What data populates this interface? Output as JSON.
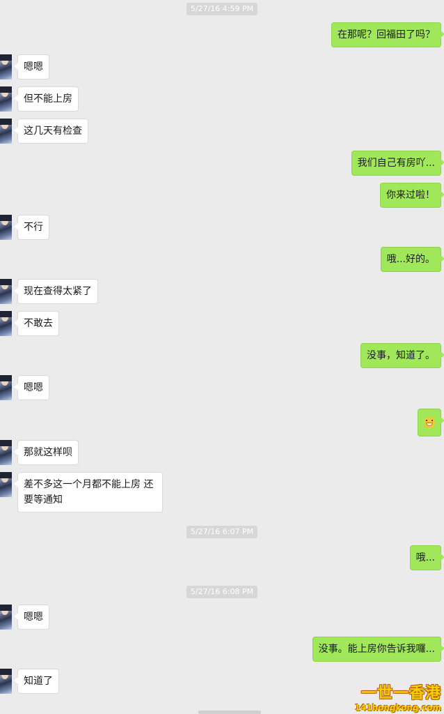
{
  "timestamps": [
    "5/27/16 4:59 PM",
    "5/27/16 6:07 PM",
    "5/27/16 6:08 PM"
  ],
  "messages": [
    {
      "side": "out",
      "text": "在那呢？回福田了吗？"
    },
    {
      "side": "in",
      "text": "嗯嗯"
    },
    {
      "side": "in",
      "text": "但不能上房"
    },
    {
      "side": "in",
      "text": "这几天有检查"
    },
    {
      "side": "out",
      "text": "我们自己有房吖..."
    },
    {
      "side": "out",
      "text": "你来过啦！"
    },
    {
      "side": "in",
      "text": "不行"
    },
    {
      "side": "out",
      "text": "哦...好的。"
    },
    {
      "side": "in",
      "text": "现在查得太紧了"
    },
    {
      "side": "in",
      "text": "不敢去"
    },
    {
      "side": "out",
      "text": "没事，知道了。"
    },
    {
      "side": "in",
      "text": "嗯嗯"
    },
    {
      "side": "out",
      "text": "",
      "icon": "grinning-emoji-icon"
    },
    {
      "side": "in",
      "text": "那就这样呗"
    },
    {
      "side": "in",
      "text": "差不多这一个月都不能上房 还要等通知"
    },
    {
      "side": "out",
      "text": "哦..."
    },
    {
      "side": "in",
      "text": "嗯嗯"
    },
    {
      "side": "out",
      "text": "没事。能上房你告诉我囉..."
    },
    {
      "side": "in",
      "text": "知道了"
    }
  ],
  "watermark": {
    "main": "一世一香港",
    "sub": "141hongkong.com"
  },
  "colors": {
    "background": "#ebebeb",
    "outgoing_bubble": "#a0e75a",
    "incoming_bubble": "#ffffff",
    "timestamp_bg": "#d7d7d7"
  }
}
